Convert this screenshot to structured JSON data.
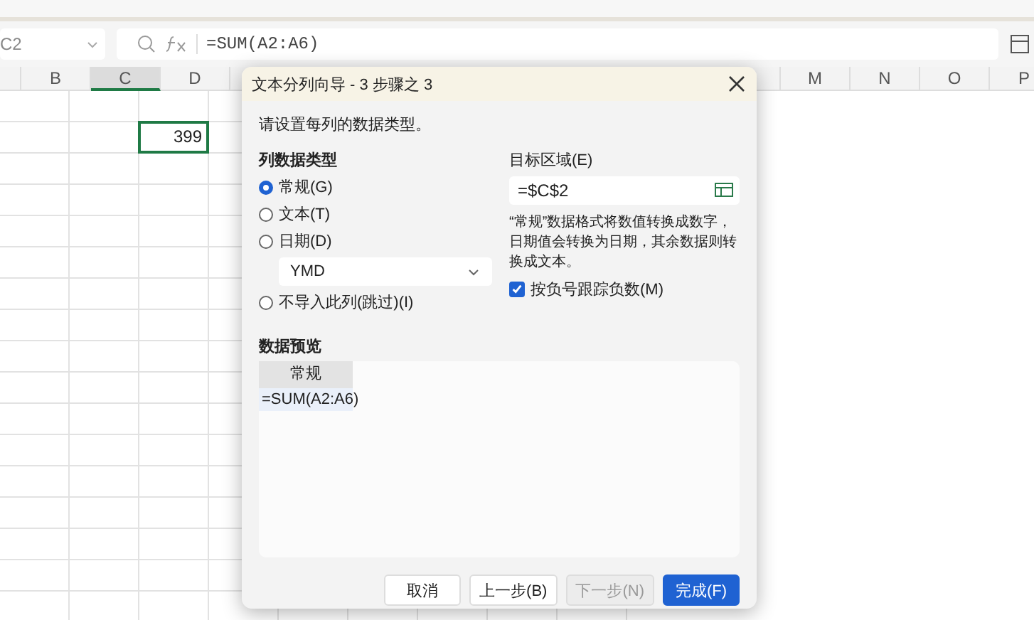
{
  "formula_bar": {
    "name_box": "C2",
    "formula": "=SUM(A2:A6)"
  },
  "sheet": {
    "columns": [
      {
        "label": "B",
        "selected": false
      },
      {
        "label": "C",
        "selected": true
      },
      {
        "label": "D",
        "selected": false
      }
    ],
    "right_columns": [
      {
        "label": "M"
      },
      {
        "label": "N"
      },
      {
        "label": "O"
      },
      {
        "label": "P"
      }
    ],
    "cell_value": "399"
  },
  "dialog": {
    "title": "文本分列向导 - 3 步骤之 3",
    "instruction": "请设置每列的数据类型。",
    "column_type_heading": "列数据类型",
    "types": [
      {
        "label": "常规(G)",
        "selected": true
      },
      {
        "label": "文本(T)",
        "selected": false
      },
      {
        "label": "日期(D)",
        "selected": false
      },
      {
        "label": "不导入此列(跳过)(I)",
        "selected": false
      }
    ],
    "date_format": "YMD",
    "destination_label": "目标区域(E)",
    "destination": "=$C$2",
    "description": "“常规”数据格式将数值转换成数字，日期值会转换为日期，其余数据则转换成文本。",
    "negative_checkbox": {
      "label": "按负号跟踪负数(M)",
      "checked": true
    },
    "preview_heading": "数据预览",
    "preview_header": "常规",
    "preview_cell": "=SUM(A2:A6)",
    "buttons": [
      {
        "label": "取消",
        "kind": "normal",
        "disabled": false
      },
      {
        "label": "上一步(B)",
        "kind": "normal",
        "disabled": false
      },
      {
        "label": "下一步(N)",
        "kind": "normal",
        "disabled": true
      },
      {
        "label": "完成(F)",
        "kind": "primary",
        "disabled": false
      }
    ]
  }
}
